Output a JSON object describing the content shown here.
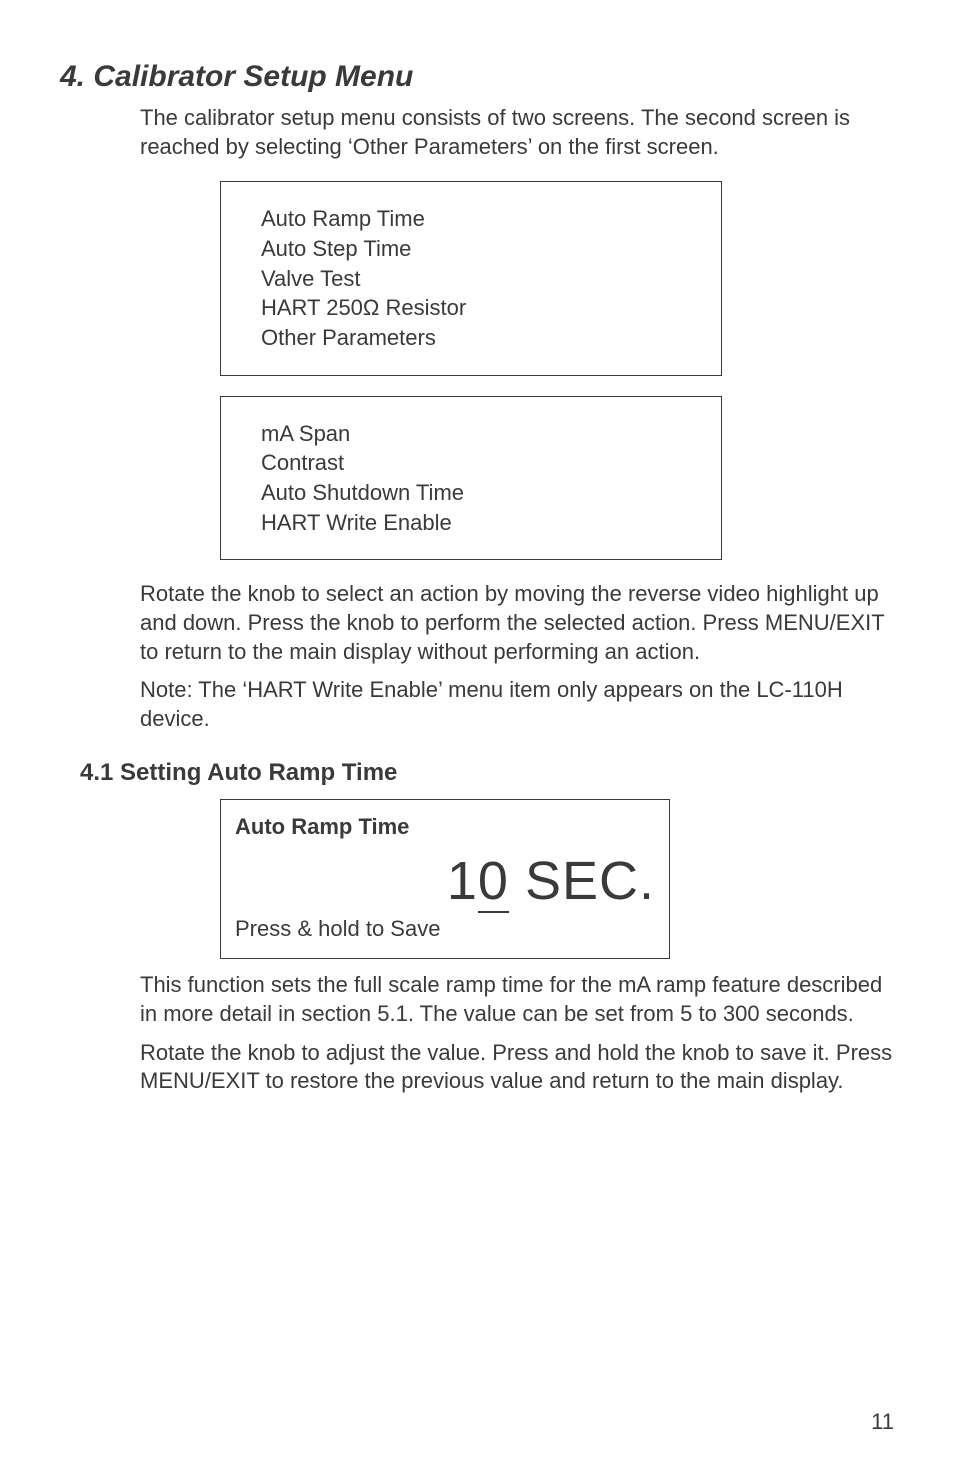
{
  "title": "4. Calibrator Setup Menu",
  "intro": "The calibrator setup menu consists of two screens.  The second screen is reached by selecting ‘Other Parameters’ on the first screen.",
  "menu1": {
    "items": [
      "Auto Ramp Time",
      "Auto Step Time",
      "Valve Test",
      "HART 250Ω Resistor",
      "Other Parameters"
    ]
  },
  "menu2": {
    "items": [
      "mA Span",
      "Contrast",
      "Auto Shutdown Time",
      "HART Write Enable"
    ]
  },
  "para1": "Rotate the knob to select an action by moving the reverse video highlight up and down.  Press the knob to perform the selected action.  Press MENU/EXIT to return to the main display without performing an action.",
  "para2": "Note: The ‘HART Write Enable’ menu item only appears on the LC-110H device.",
  "subheading": "4.1 Setting Auto Ramp Time",
  "autoramp": {
    "title": "Auto Ramp Time",
    "value_digit1": "1",
    "value_digit0": "0",
    "unit": " SEC.",
    "footer": "Press & hold to Save"
  },
  "para3": "This function sets the full scale ramp time for the mA ramp feature described in more detail in section 5.1.  The value can be set from 5 to 300 seconds.",
  "para4": "Rotate the knob to adjust the value.  Press and hold the knob to save it.  Press MENU/EXIT to restore the previous value and return to the main display.",
  "page_number": "11"
}
